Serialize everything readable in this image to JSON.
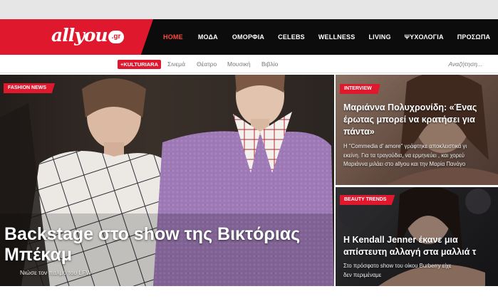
{
  "header": {
    "logo": "allyou",
    "logo_suffix": ".gr",
    "nav": [
      {
        "label": "HOME",
        "active": true
      },
      {
        "label": "ΜΟΔΑ"
      },
      {
        "label": "ΟΜΟΡΦΙΑ"
      },
      {
        "label": "CELEBS"
      },
      {
        "label": "WELLNESS"
      },
      {
        "label": "LIVING"
      },
      {
        "label": "ΨΥΧΟΛΟΓΙΑ"
      },
      {
        "label": "ΠΡΟΣΩΠΑ"
      }
    ]
  },
  "subnav": {
    "badge": "+KULTURIARA",
    "links": [
      "Σινεμά",
      "Θέατρο",
      "Μουσική",
      "Βιβλίο"
    ],
    "search_placeholder": "Αναζήτηση..."
  },
  "hero": {
    "tag": "FASHION NEWS",
    "title_line1": "Backstage στο show της Βικτόριας",
    "title_line2": "Μπέκαμ",
    "subtitle": "Νιώσε τον παλμό του LFW"
  },
  "cards": [
    {
      "tag": "INTERVIEW",
      "title_lines": [
        "Μαριάννα Πολυχρονίδη: «Ένας",
        "έρωτας μπορεί να κρατήσει για",
        "πάντα»"
      ],
      "text_lines": [
        "Η \"Commedia d' amore\" γράφτηκε αποκλειστικά γι",
        "εκείνη. Για τα τραγούδια, να ερμηνεύει , και χορεύ",
        "Μαριάννα μιλάει στο allyou και την Μαρία Πανάγο"
      ]
    },
    {
      "tag": "BEAUTY TRENDS",
      "title_lines": [
        "Η Kendall Jenner έκανε μια",
        "απίστευτη αλλαγή στα μαλλιά τ"
      ],
      "text_lines": [
        "Στο πρόσφατο show του οίκου Burberry είχε",
        "δεν περιμέναμε"
      ]
    }
  ],
  "colors": {
    "brand_red": "#e0182d",
    "header_bg": "#0c0c0c",
    "active_nav": "#ff4a3d"
  }
}
